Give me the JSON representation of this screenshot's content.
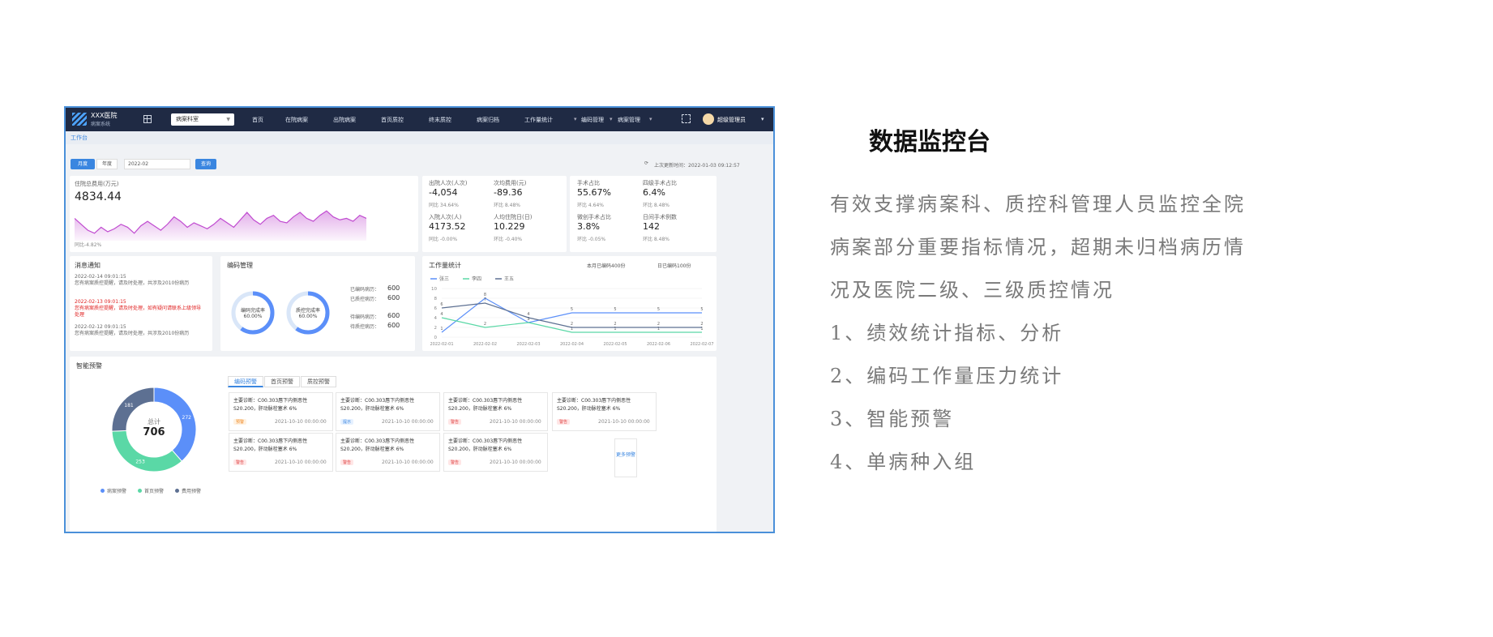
{
  "dashboard": {
    "nav": {
      "brand_name": "XXX医院",
      "brand_sub": "病案系统",
      "dept_select": "病案科室",
      "items": [
        "首页",
        "在院病案",
        "出院病案",
        "首页质控",
        "终末质控",
        "病案归档",
        "工作量统计",
        "编码管理",
        "病案管理"
      ],
      "user": "超级管理员"
    },
    "tab": "工作台",
    "filter": {
      "btn_month": "月度",
      "btn_year": "年度",
      "date": "2022-02",
      "query": "查询",
      "update": "上次更新时间：2022-01-03 09:12:57"
    },
    "revenue_card": {
      "label": "住院总费用(万元)",
      "value": "4834.44",
      "compare": "同比-4.82%"
    },
    "kpis": [
      {
        "label": "出院人次(人次)",
        "value": "-4,054",
        "compare": "同比 34.64%"
      },
      {
        "label": "次均费用(元)",
        "value": "-89.36",
        "compare": "环比 8.48%"
      },
      {
        "label": "入院人次(人)",
        "value": "4173.52",
        "compare": "同比 -0.00%"
      },
      {
        "label": "人均住院日(日)",
        "value": "10.229",
        "compare": "环比 -0.40%"
      },
      {
        "label": "手术占比",
        "value": "55.67%",
        "compare": "环比 4.64%"
      },
      {
        "label": "四级手术占比",
        "value": "6.4%",
        "compare": "环比 8.48%"
      },
      {
        "label": "微创手术占比",
        "value": "3.8%",
        "compare": "环比 -0.05%"
      },
      {
        "label": "日间手术例数",
        "value": "142",
        "compare": "环比 8.48%"
      }
    ],
    "notice": {
      "title": "消息通知",
      "items": [
        {
          "time": "2022-02-14 09:01:15",
          "text": "您有病案质控提醒，请及时处理，共涉及2010份病历",
          "red": false
        },
        {
          "time": "2022-02-13 09:01:15",
          "text": "您有病案质控提醒，请及时处理，如有疑问请联系上级领导处理",
          "red": true
        },
        {
          "time": "2022-02-12 09:01:15",
          "text": "您有病案质控提醒，请及时处理，共涉及2010份病历",
          "red": false
        }
      ]
    },
    "coding": {
      "title": "编码管理",
      "ring1": {
        "name": "编码完成率",
        "pct": "60.00%",
        "value": 0.6
      },
      "ring2": {
        "name": "质控完成率",
        "pct": "60.00%",
        "value": 0.6
      },
      "stats": [
        {
          "label": "已编码病历：",
          "value": "600"
        },
        {
          "label": "已质控病历：",
          "value": "600"
        },
        {
          "label": "待编码病历：",
          "value": "600"
        },
        {
          "label": "待质控病历：",
          "value": "600"
        }
      ]
    },
    "workload": {
      "title": "工作量统计",
      "month_note": "本月已编码400份",
      "day_note": "日已编码100份",
      "legend": [
        "张三",
        "李四",
        "王五"
      ]
    },
    "warnings": {
      "title": "智能预警",
      "donut_total_label": "总计",
      "donut_total": "706",
      "legend": [
        "病案预警",
        "首页预警",
        "费用预警"
      ],
      "tabs": [
        "编码预警",
        "首页预警",
        "质控预警"
      ],
      "cards": [
        {
          "t1": "主要诊断：C00.303唇下内侧恶性",
          "t2": "S20.200，肝动脉栓塞术 6%",
          "tag": "预警",
          "tagc": "orange",
          "date": "2021-10-10 00:00:00"
        },
        {
          "t1": "主要诊断：C00.303唇下内侧恶性",
          "t2": "S20.200，肝动脉栓塞术 6%",
          "tag": "提示",
          "tagc": "blue",
          "date": "2021-10-10 00:00:00"
        },
        {
          "t1": "主要诊断：C00.303唇下内侧恶性",
          "t2": "S20.200，肝动脉栓塞术 6%",
          "tag": "警告",
          "tagc": "red",
          "date": "2021-10-10 00:00:00"
        },
        {
          "t1": "主要诊断：C00.303唇下内侧恶性",
          "t2": "S20.200，肝动脉栓塞术 6%",
          "tag": "警告",
          "tagc": "red",
          "date": "2021-10-10 00:00:00"
        },
        {
          "t1": "主要诊断：C00.303唇下内侧恶性",
          "t2": "S20.200，肝动脉栓塞术 6%",
          "tag": "警告",
          "tagc": "red",
          "date": "2021-10-10 00:00:00"
        },
        {
          "t1": "主要诊断：C00.303唇下内侧恶性",
          "t2": "S20.200，肝动脉栓塞术 6%",
          "tag": "警告",
          "tagc": "red",
          "date": "2021-10-10 00:00:00"
        },
        {
          "t1": "主要诊断：C00.303唇下内侧恶性",
          "t2": "S20.200，肝动脉栓塞术 6%",
          "tag": "警告",
          "tagc": "red",
          "date": "2021-10-10 00:00:00"
        }
      ],
      "more": "更多预警"
    }
  },
  "chart_data": [
    {
      "type": "area",
      "title": "住院总费用(万元)",
      "values": [
        3.0,
        2.6,
        2.2,
        2.0,
        2.4,
        2.1,
        2.3,
        2.6,
        2.4,
        2.0,
        2.5,
        2.8,
        2.5,
        2.2,
        2.6,
        3.1,
        2.8,
        2.4,
        2.7,
        2.5,
        2.3,
        2.6,
        3.0,
        2.7,
        2.4,
        2.9,
        3.4,
        2.9,
        2.6,
        3.0,
        3.2,
        2.8,
        2.7,
        3.1,
        3.4,
        3.0,
        2.8,
        3.2,
        3.5,
        3.1,
        2.9,
        3.0,
        2.8,
        3.2,
        3.0
      ],
      "color": "#c04bd0"
    },
    {
      "type": "line",
      "title": "工作量统计",
      "categories": [
        "2022-02-01",
        "2022-02-02",
        "2022-02-03",
        "2022-02-04",
        "2022-02-05",
        "2022-02-06",
        "2022-02-07"
      ],
      "ylim": [
        0,
        10
      ],
      "yticks": [
        0,
        2,
        4,
        6,
        8,
        10
      ],
      "series": [
        {
          "name": "张三",
          "values": [
            1,
            8,
            3,
            5,
            5,
            5,
            5
          ],
          "color": "#5b8ff9"
        },
        {
          "name": "李四",
          "values": [
            4,
            2,
            3,
            1,
            1,
            1,
            1
          ],
          "color": "#5ad8a6"
        },
        {
          "name": "王五",
          "values": [
            6,
            7,
            4,
            2,
            2,
            2,
            2
          ],
          "color": "#5d7092"
        }
      ],
      "point_labels": [
        [
          "1",
          "8",
          "3",
          "5",
          "5",
          "5",
          "5"
        ],
        [
          "4",
          "2",
          "3",
          "1",
          "1",
          "1",
          "1"
        ],
        [
          "6",
          "7",
          "4",
          "2",
          "2",
          "2",
          "2"
        ]
      ]
    },
    {
      "type": "pie",
      "title": "智能预警",
      "series": [
        {
          "name": "病案预警",
          "value": 272,
          "color": "#5b8ff9"
        },
        {
          "name": "首页预警",
          "value": 253,
          "color": "#5ad8a6"
        },
        {
          "name": "费用预警",
          "value": 181,
          "color": "#5d7092"
        }
      ]
    }
  ],
  "intro": {
    "title": "数据监控台",
    "desc": [
      "有效支撑病案科、质控科管理人员监控全院",
      "病案部分重要指标情况，超期未归档病历情",
      "况及医院二级、三级质控情况"
    ],
    "points": [
      "1、绩效统计指标、分析",
      "2、编码工作量压力统计",
      "3、智能预警",
      "4、单病种入组"
    ]
  }
}
